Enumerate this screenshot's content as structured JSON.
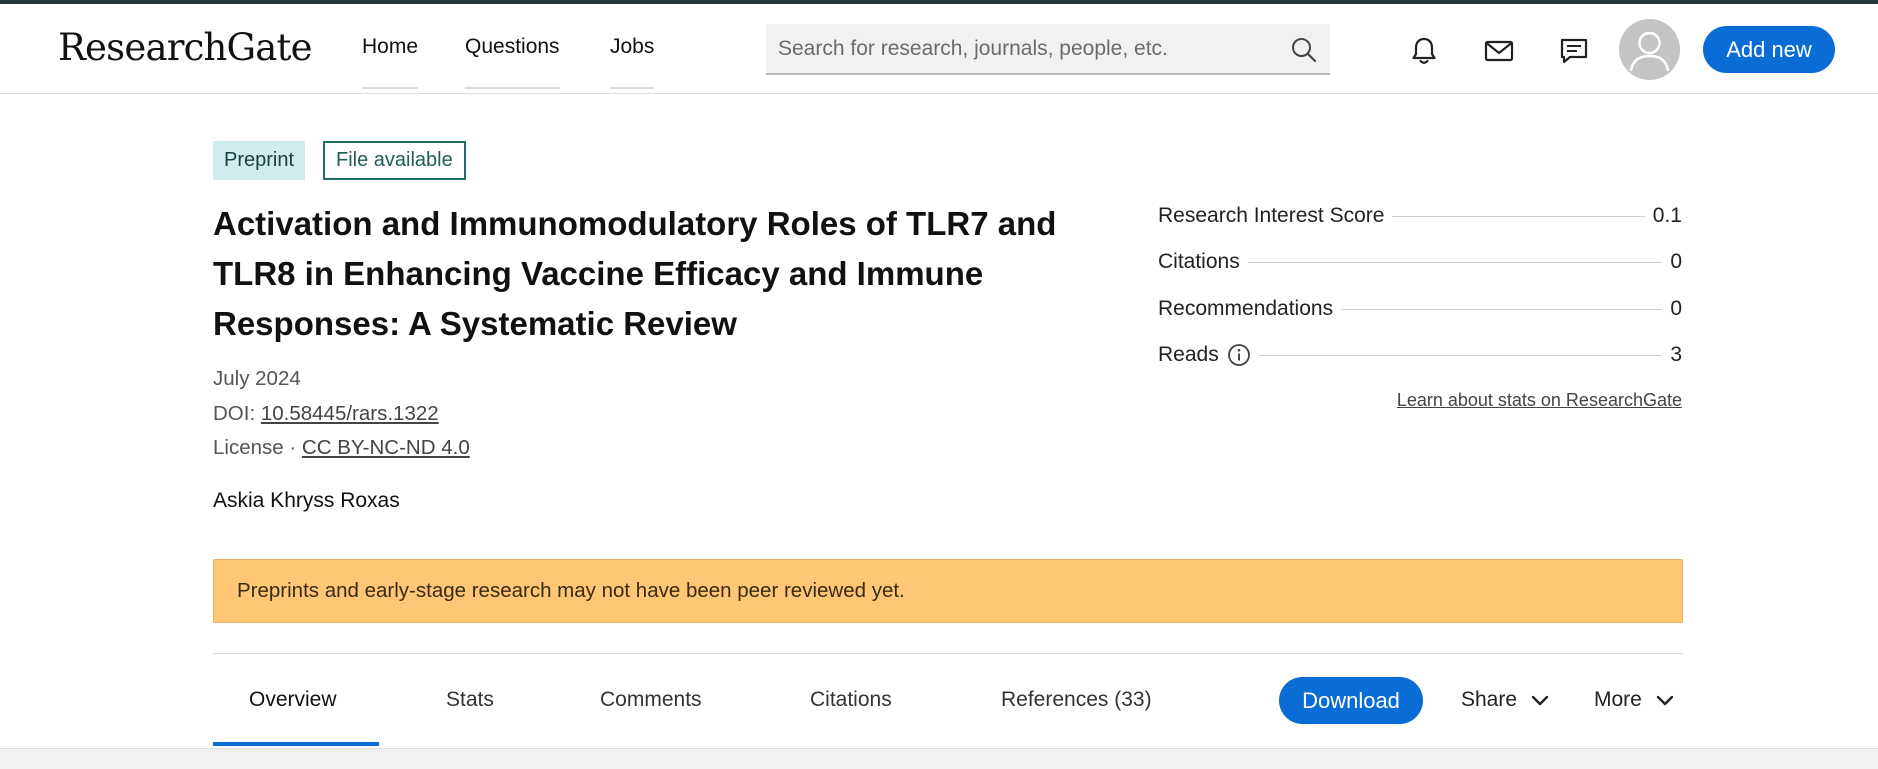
{
  "header": {
    "logo": "ResearchGate",
    "nav": {
      "home": "Home",
      "questions": "Questions",
      "jobs": "Jobs"
    },
    "search_placeholder": "Search for research, journals, people, etc.",
    "add_new": "Add new",
    "icons": [
      "bell-icon",
      "mail-icon",
      "chat-icon",
      "search-icon",
      "avatar"
    ]
  },
  "badges": {
    "preprint": "Preprint",
    "file_available": "File available"
  },
  "paper": {
    "title": "Activation and Immunomodulatory Roles of TLR7 and TLR8 in Enhancing Vaccine Efficacy and Immune Responses: A Systematic Review",
    "date": "July 2024",
    "doi_label": "DOI: ",
    "doi": "10.58445/rars.1322",
    "license_label": "License · ",
    "license": "CC BY-NC-ND 4.0",
    "author": "Askia Khryss Roxas"
  },
  "stats": {
    "research_interest_label": "Research Interest Score",
    "research_interest_value": "0.1",
    "citations_label": "Citations",
    "citations_value": "0",
    "recommendations_label": "Recommendations",
    "recommendations_value": "0",
    "reads_label": "Reads",
    "reads_value": "3",
    "learn_link": "Learn about stats on ResearchGate"
  },
  "warning": "Preprints and early-stage research may not have been peer reviewed yet.",
  "tabs": {
    "overview": "Overview",
    "stats": "Stats",
    "comments": "Comments",
    "citations": "Citations",
    "references": "References (33)"
  },
  "actions": {
    "download": "Download",
    "share": "Share",
    "more": "More"
  },
  "colors": {
    "accent": "#0a6dd6",
    "warning_bg": "#ffc675",
    "preprint_bg": "#d0ecec",
    "file_border": "#1f6f68"
  }
}
